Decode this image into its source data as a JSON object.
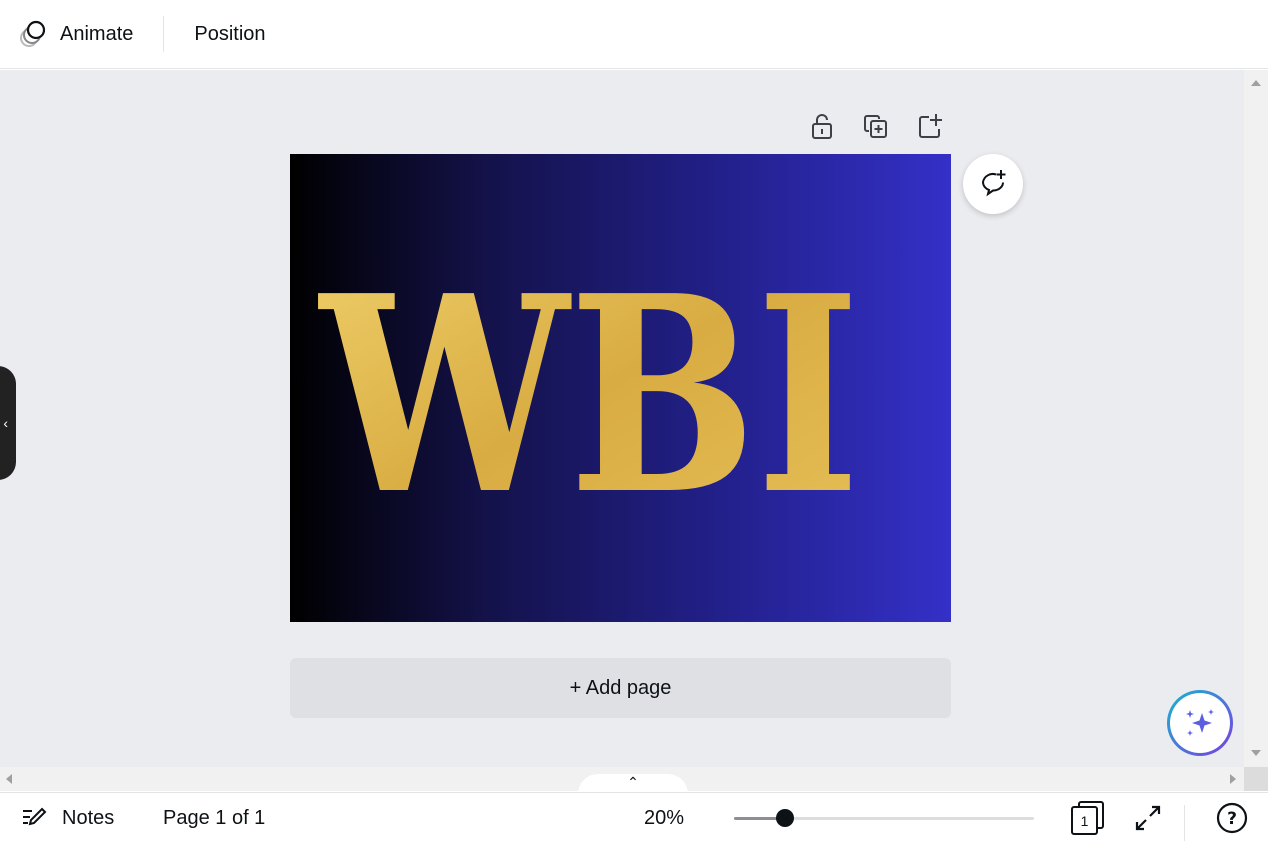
{
  "toolbar": {
    "animate_label": "Animate",
    "position_label": "Position"
  },
  "design": {
    "text": "WBI",
    "gradient_colors": [
      "#000000",
      "#3430c8"
    ],
    "text_color": "#e2b64e"
  },
  "canvas": {
    "add_page_label": "+ Add page",
    "page_actions": [
      "lock-icon",
      "duplicate-page-icon",
      "add-page-icon"
    ]
  },
  "footer": {
    "notes_label": "Notes",
    "page_indicator": "Page 1 of 1",
    "zoom": "20%",
    "zoom_percent": 20,
    "page_count": "1"
  }
}
